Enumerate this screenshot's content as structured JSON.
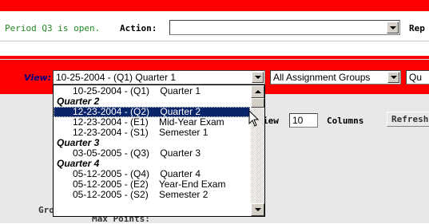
{
  "status": {
    "period_text": "Period Q3 is open.",
    "action_label": "Action:",
    "action_value": "",
    "rep_label": "Rep"
  },
  "view": {
    "label": "View:",
    "selected_value": "10-25-2004 - (Q1)    Quarter 1",
    "group_select_value": "All Assignment Groups",
    "third_select_value": "Qu"
  },
  "dropdown": {
    "options": [
      {
        "type": "option",
        "text": "10-25-2004 - (Q1)    Quarter 1",
        "selected": false
      },
      {
        "type": "group",
        "text": "Quarter 2"
      },
      {
        "type": "option",
        "text": "12-23-2004 - (Q2)    Quarter 2",
        "selected": true
      },
      {
        "type": "option",
        "text": "12-23-2004 - (E1)    Mid-Year Exam",
        "selected": false
      },
      {
        "type": "option",
        "text": "12-23-2004 - (S1)    Semester 1",
        "selected": false
      },
      {
        "type": "group",
        "text": "Quarter 3"
      },
      {
        "type": "option",
        "text": "03-05-2005 - (Q3)    Quarter 3",
        "selected": false
      },
      {
        "type": "group",
        "text": "Quarter 4"
      },
      {
        "type": "option",
        "text": "05-12-2005 - (Q4)    Quarter 4",
        "selected": false
      },
      {
        "type": "option",
        "text": "05-12-2005 - (E2)    Year-End Exam",
        "selected": false
      },
      {
        "type": "option",
        "text": "05-12-2005 - (S2)    Semester 2",
        "selected": false
      }
    ]
  },
  "controls": {
    "view_partial": "iew",
    "columns_value": "10",
    "columns_label": "Columns",
    "refresh_label": "Refresh",
    "grade_partial": "Gro",
    "max_points_label": "Max Points:"
  },
  "colors": {
    "red": "#ff0000",
    "selection": "#0a246a",
    "period_green": "#1f8a1f",
    "view_navy": "#000080"
  }
}
